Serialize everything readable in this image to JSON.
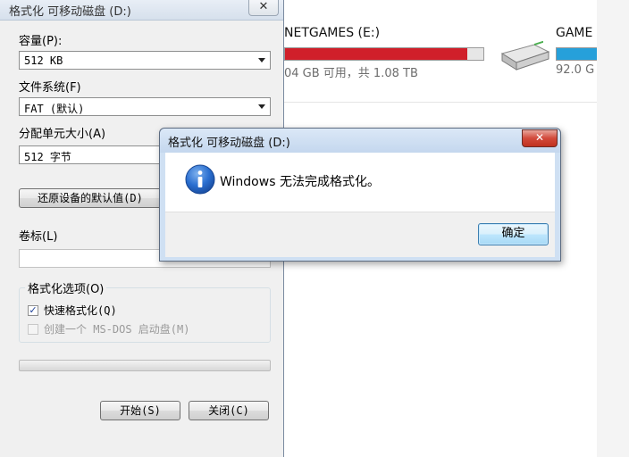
{
  "explorer": {
    "drive_e": {
      "label": "NETGAMES (E:)",
      "usage": "04 GB 可用，共 1.08 TB",
      "used_fraction": 0.92,
      "bar_color": "#d01f2a"
    },
    "drive_f": {
      "label": "GAME",
      "usage": "92.0 G",
      "bar_color": "#26a0da"
    }
  },
  "format_dialog": {
    "title": "格式化 可移动磁盘 (D:)",
    "capacity_label": "容量(P):",
    "capacity_value": "512 KB",
    "filesystem_label": "文件系统(F)",
    "filesystem_value": "FAT (默认)",
    "alloc_label": "分配单元大小(A)",
    "alloc_value": "512 字节",
    "restore_defaults": "还原设备的默认值(D)",
    "volume_label": "卷标(L)",
    "volume_value": "",
    "options_group": "格式化选项(O)",
    "quick_format": "快速格式化(Q)",
    "quick_format_checked": true,
    "msdos_boot": "创建一个 MS-DOS 启动盘(M)",
    "msdos_boot_checked": false,
    "start_button": "开始(S)",
    "close_button": "关闭(C)",
    "close_icon": "✕"
  },
  "message_box": {
    "title": "格式化 可移动磁盘 (D:)",
    "message": "Windows 无法完成格式化。",
    "ok_button": "确定",
    "close_icon": "✕",
    "icon": "info-icon",
    "accent_color": "#1f5fbf"
  }
}
